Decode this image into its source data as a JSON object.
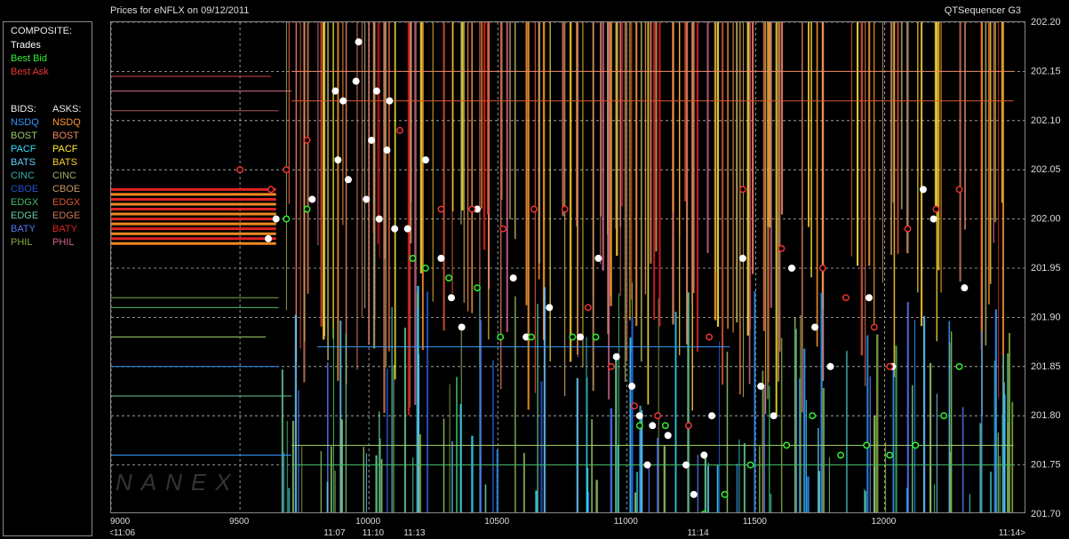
{
  "header": {
    "title": "Prices for  eNFLX  on  09/12/2011",
    "app_name": "QTSequencer G3"
  },
  "legend_panel": {
    "composite_header": "COMPOSITE:",
    "composite": [
      {
        "label": "Trades",
        "color": "#ffffff"
      },
      {
        "label": "Best Bid",
        "color": "#33ee33"
      },
      {
        "label": "Best Ask",
        "color": "#ee3333"
      }
    ],
    "bids_header": "BIDS:",
    "asks_header": "ASKS:",
    "bids": [
      {
        "label": "NSDQ",
        "color": "#3399ff"
      },
      {
        "label": "BOST",
        "color": "#99cc66"
      },
      {
        "label": "PACF",
        "color": "#33ddff"
      },
      {
        "label": "BATS",
        "color": "#66ccff"
      },
      {
        "label": "CINC",
        "color": "#33aaaa"
      },
      {
        "label": "CBOE",
        "color": "#2255cc"
      },
      {
        "label": "EDGX",
        "color": "#44bb66"
      },
      {
        "label": "EDGE",
        "color": "#66cc99"
      },
      {
        "label": "BATY",
        "color": "#5577ee"
      },
      {
        "label": "PHIL",
        "color": "#88aa44"
      }
    ],
    "asks": [
      {
        "label": "NSDQ",
        "color": "#ff9933"
      },
      {
        "label": "BOST",
        "color": "#ee8866"
      },
      {
        "label": "PACF",
        "color": "#ffee33"
      },
      {
        "label": "BATS",
        "color": "#ffcc33"
      },
      {
        "label": "CINC",
        "color": "#aaaa66"
      },
      {
        "label": "CBOE",
        "color": "#cc9966"
      },
      {
        "label": "EDGX",
        "color": "#dd5533"
      },
      {
        "label": "EDGE",
        "color": "#cc7755"
      },
      {
        "label": "BATY",
        "color": "#dd2222"
      },
      {
        "label": "PHIL",
        "color": "#cc6688"
      }
    ]
  },
  "watermark": "NANEX",
  "chart_data": {
    "type": "scatter",
    "title": "Prices for  eNFLX  on  09/12/2011",
    "xlim": [
      9000,
      12550
    ],
    "ylim": [
      201.7,
      202.2
    ],
    "x_ticks": [
      {
        "value": 9000,
        "label": "9000"
      },
      {
        "value": 9500,
        "label": "9500"
      },
      {
        "value": 10000,
        "label": "10000"
      },
      {
        "value": 10500,
        "label": "10500"
      },
      {
        "value": 11000,
        "label": "11000"
      },
      {
        "value": 11500,
        "label": "11500"
      },
      {
        "value": 12000,
        "label": "12000"
      }
    ],
    "time_ticks": [
      {
        "value": 9000,
        "label": "<11:06"
      },
      {
        "value": 9870,
        "label": "11:07"
      },
      {
        "value": 10020,
        "label": "11:10"
      },
      {
        "value": 10180,
        "label": "11:13"
      },
      {
        "value": 11280,
        "label": "11:14"
      },
      {
        "value": 12550,
        "label": "11:14>"
      }
    ],
    "y_ticks": [
      201.7,
      201.75,
      201.8,
      201.85,
      201.9,
      201.95,
      202.0,
      202.05,
      202.1,
      202.15,
      202.2
    ],
    "grid": true,
    "series": [
      {
        "name": "Trades",
        "color": "#ffffff",
        "points": [
          [
            9960,
            202.18
          ],
          [
            9870,
            202.13
          ],
          [
            9900,
            202.12
          ],
          [
            9950,
            202.14
          ],
          [
            10030,
            202.13
          ],
          [
            10080,
            202.12
          ],
          [
            9880,
            202.06
          ],
          [
            9920,
            202.04
          ],
          [
            9990,
            202.02
          ],
          [
            10040,
            202.0
          ],
          [
            10100,
            201.99
          ],
          [
            10150,
            201.99
          ],
          [
            9610,
            201.98
          ],
          [
            9640,
            202.0
          ],
          [
            9780,
            202.02
          ],
          [
            10010,
            202.08
          ],
          [
            10070,
            202.07
          ],
          [
            10220,
            202.06
          ],
          [
            10420,
            202.01
          ],
          [
            10280,
            201.96
          ],
          [
            10320,
            201.92
          ],
          [
            10360,
            201.89
          ],
          [
            10560,
            201.94
          ],
          [
            10610,
            201.88
          ],
          [
            10700,
            201.91
          ],
          [
            10820,
            201.88
          ],
          [
            10890,
            201.96
          ],
          [
            10960,
            201.86
          ],
          [
            11020,
            201.83
          ],
          [
            11050,
            201.8
          ],
          [
            11100,
            201.79
          ],
          [
            11080,
            201.75
          ],
          [
            11160,
            201.78
          ],
          [
            11230,
            201.75
          ],
          [
            11260,
            201.72
          ],
          [
            11300,
            201.76
          ],
          [
            11330,
            201.8
          ],
          [
            11450,
            201.96
          ],
          [
            11520,
            201.83
          ],
          [
            11570,
            201.8
          ],
          [
            11640,
            201.95
          ],
          [
            11730,
            201.89
          ],
          [
            11790,
            201.85
          ],
          [
            11940,
            201.92
          ],
          [
            12030,
            201.85
          ],
          [
            12150,
            202.03
          ],
          [
            12190,
            202.0
          ],
          [
            12310,
            201.93
          ]
        ]
      },
      {
        "name": "Best Bid",
        "color": "#33ee33",
        "points": [
          [
            9680,
            202.0
          ],
          [
            9760,
            202.01
          ],
          [
            10170,
            201.96
          ],
          [
            10220,
            201.95
          ],
          [
            10310,
            201.94
          ],
          [
            10420,
            201.93
          ],
          [
            10510,
            201.88
          ],
          [
            10630,
            201.88
          ],
          [
            10790,
            201.88
          ],
          [
            10880,
            201.88
          ],
          [
            11050,
            201.79
          ],
          [
            11150,
            201.79
          ],
          [
            11300,
            201.7
          ],
          [
            11380,
            201.72
          ],
          [
            11480,
            201.75
          ],
          [
            11620,
            201.77
          ],
          [
            11720,
            201.8
          ],
          [
            11830,
            201.76
          ],
          [
            11930,
            201.77
          ],
          [
            12020,
            201.76
          ],
          [
            12120,
            201.77
          ],
          [
            12230,
            201.8
          ],
          [
            12290,
            201.85
          ]
        ]
      },
      {
        "name": "Best Ask",
        "color": "#ee3333",
        "points": [
          [
            9500,
            202.05
          ],
          [
            9620,
            202.03
          ],
          [
            9680,
            202.05
          ],
          [
            9760,
            202.08
          ],
          [
            10120,
            202.09
          ],
          [
            10280,
            202.01
          ],
          [
            10400,
            202.01
          ],
          [
            10520,
            201.99
          ],
          [
            10640,
            202.01
          ],
          [
            10760,
            202.01
          ],
          [
            10850,
            201.91
          ],
          [
            10940,
            201.85
          ],
          [
            11030,
            201.81
          ],
          [
            11120,
            201.8
          ],
          [
            11240,
            201.79
          ],
          [
            11320,
            201.88
          ],
          [
            11450,
            202.03
          ],
          [
            11600,
            201.97
          ],
          [
            11760,
            201.95
          ],
          [
            11850,
            201.92
          ],
          [
            11960,
            201.89
          ],
          [
            12020,
            201.85
          ],
          [
            12090,
            201.99
          ],
          [
            12200,
            202.01
          ],
          [
            12290,
            202.03
          ]
        ]
      }
    ]
  }
}
